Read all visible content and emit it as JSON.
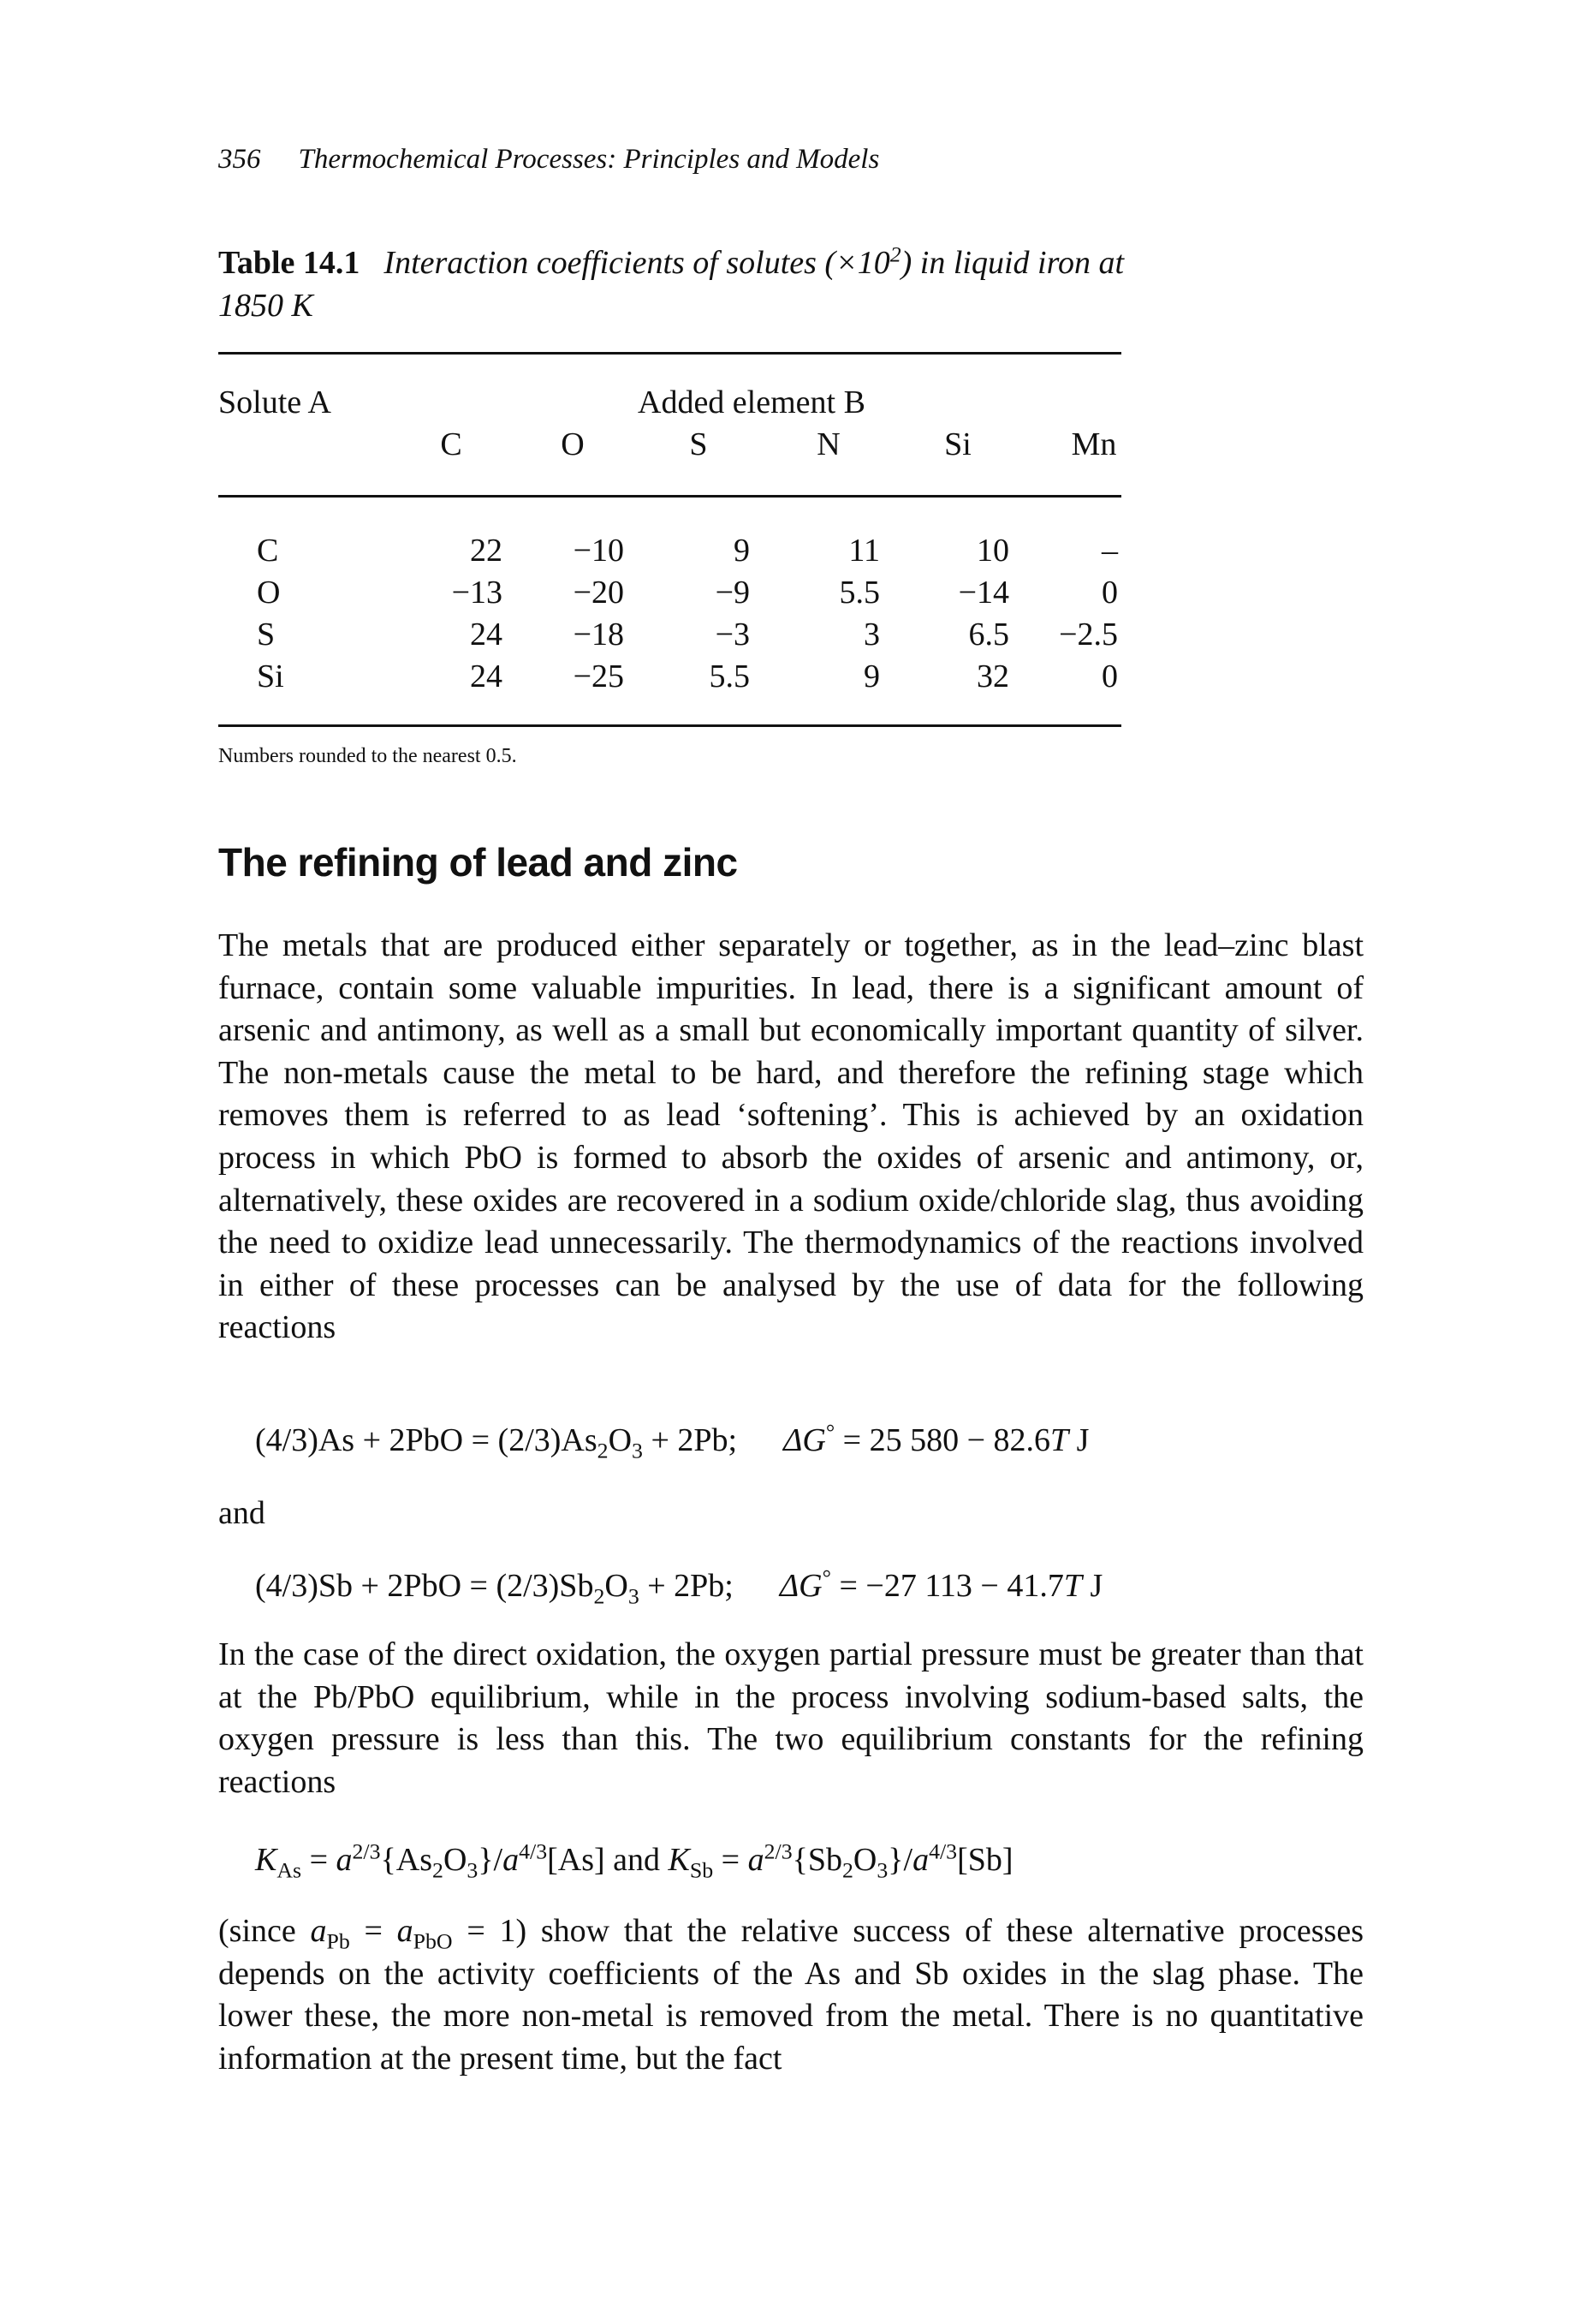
{
  "running_head": {
    "page_number": "356",
    "book_title": "Thermochemical Processes: Principles and Models"
  },
  "table": {
    "label": "Table 14.1",
    "caption_part1": "Interaction coefficients of solutes (×10",
    "caption_sup": "2",
    "caption_part2": ") in liquid iron at 1850 K",
    "row_header": "Solute A",
    "column_group_header": "Added element B",
    "columns": [
      "C",
      "O",
      "S",
      "N",
      "Si",
      "Mn"
    ],
    "rows": [
      {
        "solute": "C",
        "values": [
          "22",
          "−10",
          "9",
          "11",
          "10",
          "–"
        ]
      },
      {
        "solute": "O",
        "values": [
          "−13",
          "−20",
          "−9",
          "5.5",
          "−14",
          "0"
        ]
      },
      {
        "solute": "S",
        "values": [
          "24",
          "−18",
          "−3",
          "3",
          "6.5",
          "−2.5"
        ]
      },
      {
        "solute": "Si",
        "values": [
          "24",
          "−25",
          "5.5",
          "9",
          "32",
          "0"
        ]
      }
    ],
    "footnote": "Numbers rounded to the nearest 0.5."
  },
  "section": {
    "heading": "The refining of lead and zinc",
    "paragraph_1": "The metals that are produced either separately or together, as in the lead–zinc blast furnace, contain some valuable impurities. In lead, there is a significant amount of arsenic and antimony, as well as a small but economically important quantity of silver. The non-metals cause the metal to be hard, and therefore the refining stage which removes them is referred to as lead ‘softening’. This is achieved by an oxidation process in which PbO is formed to absorb the oxides of arsenic and antimony, or, alternatively, these oxides are recovered in a sodium oxide/chloride slag, thus avoiding the need to oxidize lead unnecessarily. The thermodynamics of the reactions involved in either of these processes can be analysed by the use of data for the following reactions",
    "equation_1": {
      "lhs": "(4/3)As + 2PbO = (2/3)As",
      "sub1": "2",
      "mid1": "O",
      "sub2": "3",
      "rhs": " + 2Pb;",
      "dg_label": "ΔG",
      "dg_sup": "°",
      "dg_value": " = 25 580 − 82.6",
      "T": "T",
      "unit": " J"
    },
    "and_word": "and",
    "equation_2": {
      "lhs": "(4/3)Sb + 2PbO = (2/3)Sb",
      "sub1": "2",
      "mid1": "O",
      "sub2": "3",
      "rhs": " + 2Pb;",
      "dg_label": "ΔG",
      "dg_sup": "°",
      "dg_value": " = −27 113 − 41.7",
      "T": "T",
      "unit": " J"
    },
    "paragraph_2": "In the case of the direct oxidation, the oxygen partial pressure must be greater than that at the Pb/PbO equilibrium, while in the process involving sodium-based salts, the oxygen pressure is less than this. The two equilibrium constants for the refining reactions",
    "equation_3": {
      "k1": "K",
      "k1_sub": "As",
      "eq1": " = ",
      "a1": "a",
      "a1_sup": "2/3",
      "oxide1_a": "{As",
      "oxide1_sub1": "2",
      "oxide1_b": "O",
      "oxide1_sub2": "3",
      "oxide1_c": "}/",
      "a2": "a",
      "a2_sup": "4/3",
      "elem1": "[As] and ",
      "k2": "K",
      "k2_sub": "Sb",
      "eq2": " = ",
      "a3": "a",
      "a3_sup": "2/3",
      "oxide2_a": "{Sb",
      "oxide2_sub1": "2",
      "oxide2_b": "O",
      "oxide2_sub2": "3",
      "oxide2_c": "}/",
      "a4": "a",
      "a4_sup": "4/3",
      "elem2": "[Sb]"
    },
    "paragraph_3_prefix": "(since ",
    "paragraph_3_a_pb": "a",
    "paragraph_3_a_pb_sub": "Pb",
    "paragraph_3_eq": " = ",
    "paragraph_3_a_pbo": "a",
    "paragraph_3_a_pbo_sub": "PbO",
    "paragraph_3_eq2": " = 1) ",
    "paragraph_3_rest": "show that the relative success of these alternative processes depends on the activity coefficients of the As and Sb oxides in the slag phase. The lower these, the more non-metal is removed from the metal. There is no quantitative information at the present time, but the fact"
  }
}
